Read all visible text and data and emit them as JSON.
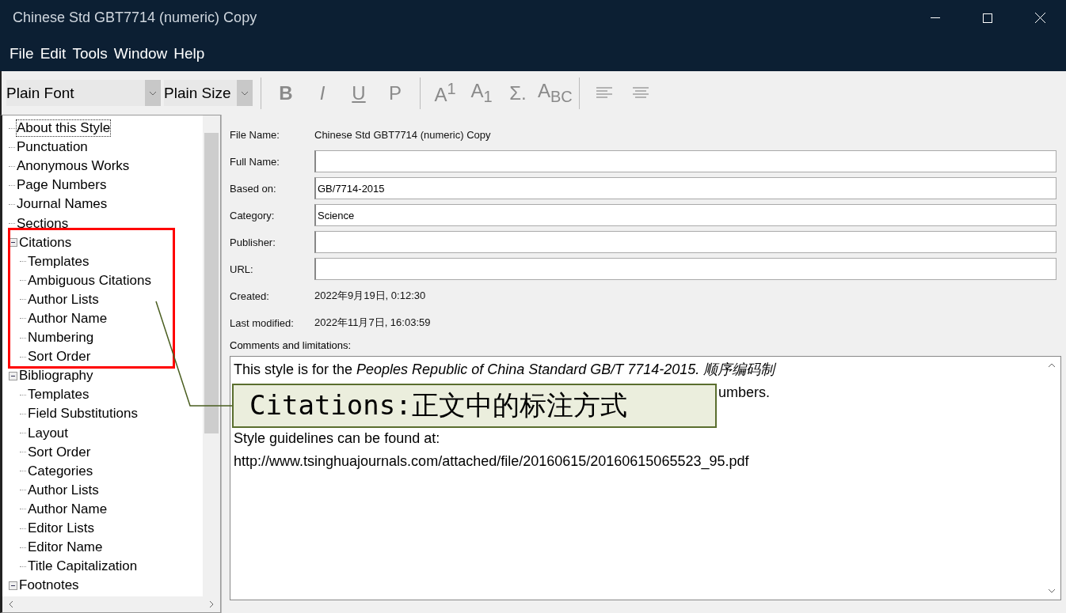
{
  "window": {
    "title": "Chinese Std GBT7714 (numeric) Copy"
  },
  "menu": [
    "File",
    "Edit",
    "Tools",
    "Window",
    "Help"
  ],
  "toolbar": {
    "font": "Plain Font",
    "size": "Plain Size",
    "buttons": [
      {
        "kind": "bold",
        "label": "B",
        "disabled": true
      },
      {
        "kind": "italic",
        "label": "I",
        "disabled": true
      },
      {
        "kind": "underline",
        "label": "U",
        "disabled": true
      },
      {
        "kind": "plain",
        "label": "P",
        "disabled": true
      },
      {
        "kind": "sep"
      },
      {
        "kind": "plain",
        "label": "A$^{1}$",
        "disabled": true
      },
      {
        "kind": "plain",
        "label": "A$_{1}$",
        "disabled": true
      },
      {
        "kind": "plain",
        "label": "Σ.",
        "disabled": true
      },
      {
        "kind": "plain",
        "label": "A$_{BC}$",
        "disabled": true
      },
      {
        "kind": "sep"
      },
      {
        "kind": "align-left"
      },
      {
        "kind": "align-center"
      }
    ]
  },
  "tree": [
    {
      "label": "About this Style",
      "selected": true
    },
    {
      "label": "Punctuation",
      "selected": false
    },
    {
      "label": "Anonymous Works",
      "selected": false
    },
    {
      "label": "Page Numbers",
      "selected": false
    },
    {
      "label": "Journal Names",
      "selected": false
    },
    {
      "label": "Sections",
      "selected": false
    },
    {
      "label": "Citations",
      "selected": false,
      "expanded": true,
      "children": [
        {
          "label": "Templates",
          "selected": false
        },
        {
          "label": "Ambiguous Citations",
          "selected": false
        },
        {
          "label": "Author Lists",
          "selected": false
        },
        {
          "label": "Author Name",
          "selected": false
        },
        {
          "label": "Numbering",
          "selected": false
        },
        {
          "label": "Sort Order",
          "selected": false
        }
      ]
    },
    {
      "label": "Bibliography",
      "selected": false,
      "expanded": true,
      "children": [
        {
          "label": "Templates",
          "selected": false
        },
        {
          "label": "Field Substitutions",
          "selected": false
        },
        {
          "label": "Layout",
          "selected": false
        },
        {
          "label": "Sort Order",
          "selected": false
        },
        {
          "label": "Categories",
          "selected": false
        },
        {
          "label": "Author Lists",
          "selected": false
        },
        {
          "label": "Author Name",
          "selected": false
        },
        {
          "label": "Editor Lists",
          "selected": false
        },
        {
          "label": "Editor Name",
          "selected": false
        },
        {
          "label": "Title Capitalization",
          "selected": false
        }
      ]
    },
    {
      "label": "Footnotes",
      "selected": false,
      "expanded": true
    }
  ],
  "form": [
    {
      "kind": "text",
      "label": "File Name:",
      "value": "Chinese Std GBT7714 (numeric) Copy"
    },
    {
      "kind": "input",
      "label": "Full Name:"
    },
    {
      "kind": "input",
      "label": "Based on:",
      "value": "GB/7714-2015"
    },
    {
      "kind": "input",
      "label": "Category:",
      "value": "Science"
    },
    {
      "kind": "input",
      "label": "Publisher:"
    },
    {
      "kind": "input",
      "label": "URL:"
    },
    {
      "kind": "text",
      "label": "Created:",
      "value": "2022年9月19日, 0:12:30"
    },
    {
      "kind": "text",
      "label": "Last modified:",
      "value": "2022年11月7日, 16:03:59"
    }
  ],
  "comments": {
    "label": "Comments and limitations:",
    "lines": [
      {
        "kind": "text",
        "text": "This style is for the *Peoples Republic of China Standard GB/T 7714-2015.* *顺序编码制*"
      },
      {
        "kind": "tail",
        "text": "umbers."
      },
      {
        "kind": "blank"
      },
      {
        "kind": "text",
        "text": "Style guidelines can be found at:"
      },
      {
        "kind": "text",
        "text": "http://www.tsinghuajournals.com/attached/file/20160615/20160615065523_95.pdf"
      }
    ]
  },
  "annotation": {
    "text": "Citations:正文中的标注方式"
  }
}
